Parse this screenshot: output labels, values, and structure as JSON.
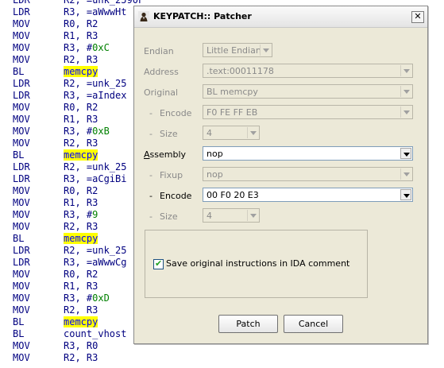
{
  "listing": [
    {
      "mnemonic": "LDR",
      "operands": "R2, =unk_2590F"
    },
    {
      "mnemonic": "LDR",
      "operands": "R3, =aWwwHt"
    },
    {
      "mnemonic": "MOV",
      "operands": "R0, R2"
    },
    {
      "mnemonic": "MOV",
      "operands": "R1, R3"
    },
    {
      "mnemonic": "MOV",
      "operands_prefix": "R3, #",
      "number": "0xC"
    },
    {
      "mnemonic": "MOV",
      "operands": "R2, R3"
    },
    {
      "mnemonic": "BL",
      "call": "memcpy"
    },
    {
      "mnemonic": "LDR",
      "operands": "R2, =unk_25"
    },
    {
      "mnemonic": "LDR",
      "operands": "R3, =aIndex"
    },
    {
      "mnemonic": "MOV",
      "operands": "R0, R2"
    },
    {
      "mnemonic": "MOV",
      "operands": "R1, R3"
    },
    {
      "mnemonic": "MOV",
      "operands_prefix": "R3, #",
      "number": "0xB"
    },
    {
      "mnemonic": "MOV",
      "operands": "R2, R3"
    },
    {
      "mnemonic": "BL",
      "call": "memcpy"
    },
    {
      "mnemonic": "LDR",
      "operands": "R2, =unk_25"
    },
    {
      "mnemonic": "LDR",
      "operands": "R3, =aCgiBi"
    },
    {
      "mnemonic": "MOV",
      "operands": "R0, R2"
    },
    {
      "mnemonic": "MOV",
      "operands": "R1, R3"
    },
    {
      "mnemonic": "MOV",
      "operands_prefix": "R3, #",
      "number": "9"
    },
    {
      "mnemonic": "MOV",
      "operands": "R2, R3"
    },
    {
      "mnemonic": "BL",
      "call": "memcpy"
    },
    {
      "mnemonic": "LDR",
      "operands": "R2, =unk_25"
    },
    {
      "mnemonic": "LDR",
      "operands": "R3, =aWwwCg"
    },
    {
      "mnemonic": "MOV",
      "operands": "R0, R2"
    },
    {
      "mnemonic": "MOV",
      "operands": "R1, R3"
    },
    {
      "mnemonic": "MOV",
      "operands_prefix": "R3, #",
      "number": "0xD"
    },
    {
      "mnemonic": "MOV",
      "operands": "R2, R3"
    },
    {
      "mnemonic": "BL",
      "call": "memcpy"
    },
    {
      "mnemonic": "BL",
      "operands": "count_vhost"
    },
    {
      "mnemonic": "MOV",
      "operands": "R3, R0"
    },
    {
      "mnemonic": "MOV",
      "operands": "R2, R3"
    }
  ],
  "dialog": {
    "title": "KEYPATCH:: Patcher",
    "close_glyph": "✕",
    "endian": {
      "label": "Endian",
      "value": "Little Endian"
    },
    "address": {
      "label": "Address",
      "value": ".text:00011178"
    },
    "original": {
      "label": "Original",
      "value": "BL memcpy"
    },
    "original_encode": {
      "dash": "-",
      "label": "Encode",
      "value": "F0 FE FF EB"
    },
    "original_size": {
      "dash": "-",
      "label": "Size",
      "value": "4"
    },
    "assembly": {
      "label_underlined": "A",
      "label_rest": "ssembly",
      "value": "nop"
    },
    "fixup": {
      "dash": "-",
      "label": "Fixup",
      "value": "nop"
    },
    "encode": {
      "dash": "-",
      "label": "Encode",
      "value": "00 F0 20 E3"
    },
    "size": {
      "dash": "-",
      "label": "Size",
      "value": "4"
    },
    "save_comment": {
      "label": "Save original instructions in IDA comment",
      "checked": true,
      "tick": "✔"
    },
    "patch_button": "Patch",
    "cancel_button": "Cancel"
  },
  "colors": {
    "listing_text": "#000080",
    "listing_number": "#008000",
    "highlight": "#ffff00",
    "dialog_face": "#ece9d8",
    "checkbox_tick": "#21a121"
  },
  "icons": [
    "app-icon",
    "dropdown-arrow-icon",
    "close-icon",
    "checkmark-icon"
  ]
}
